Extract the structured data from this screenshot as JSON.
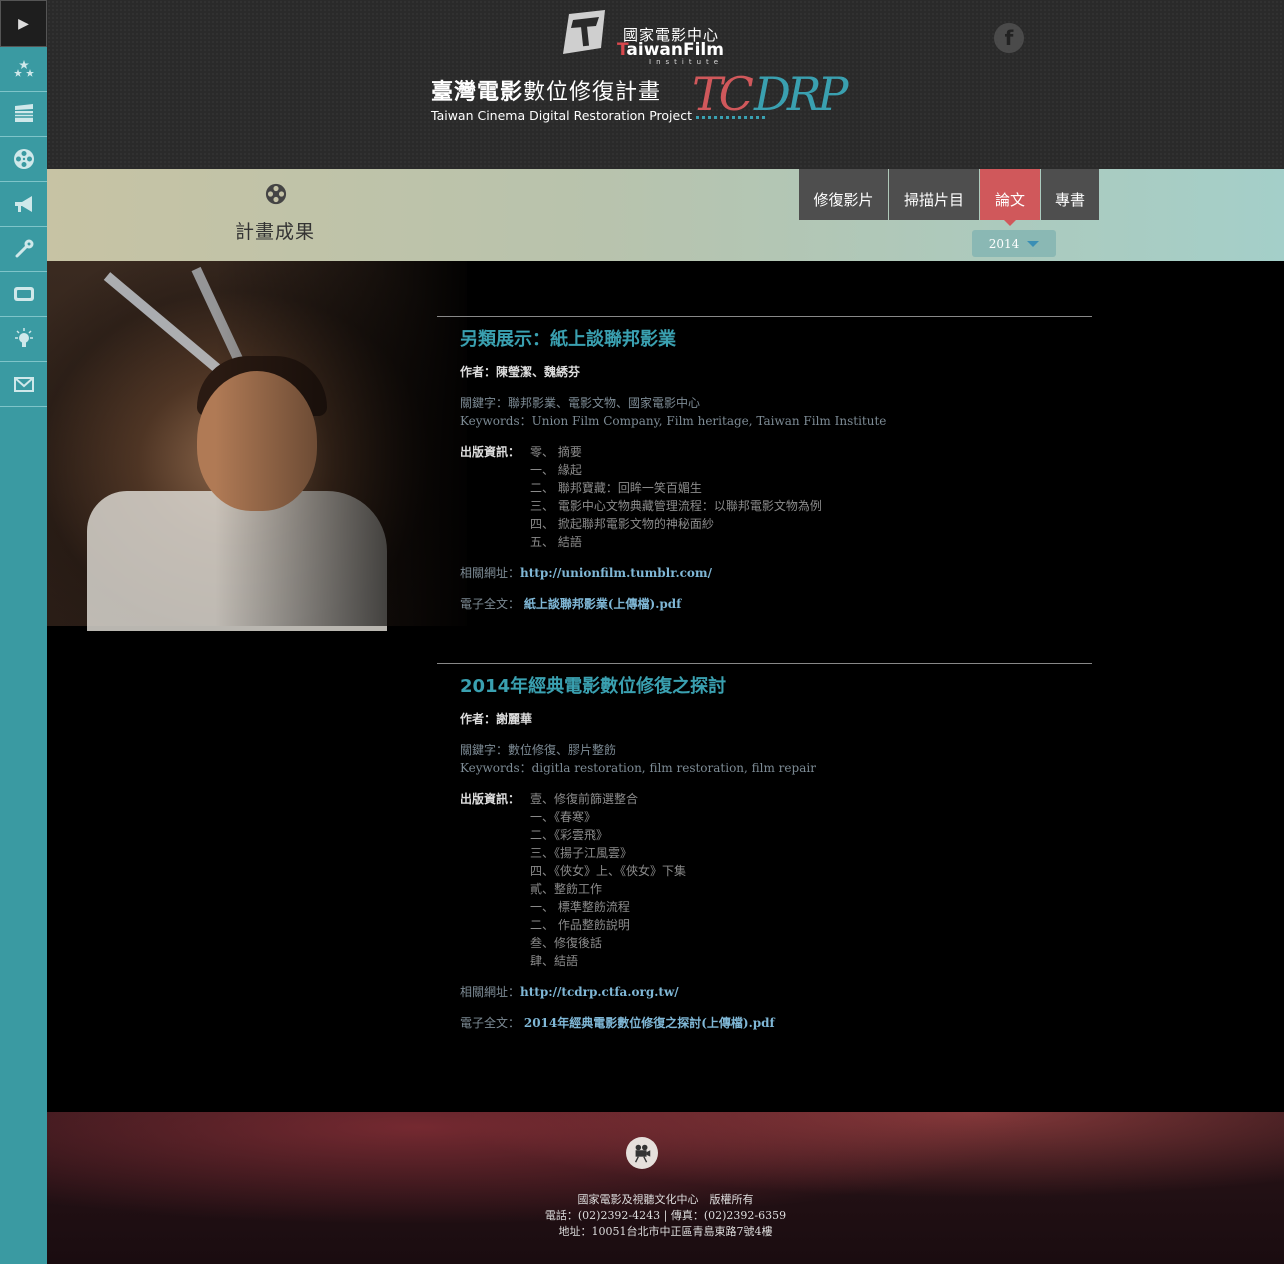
{
  "sidebar": {
    "items": [
      {
        "icon": "stars-icon"
      },
      {
        "icon": "film-clapper-icon"
      },
      {
        "icon": "film-reel-icon"
      },
      {
        "icon": "megaphone-icon"
      },
      {
        "icon": "wrench-icon"
      },
      {
        "icon": "tv-icon"
      },
      {
        "icon": "lightbulb-icon"
      },
      {
        "icon": "mail-icon"
      }
    ]
  },
  "header": {
    "tfi_zh": "國家電影中心",
    "tfi_en_t": "T",
    "tfi_en_rest": "aiwanFilm",
    "tfi_sub": "Institute",
    "project_zh_bold": "臺灣電影",
    "project_zh_light": "數位修復計畫",
    "project_en": "Taiwan Cinema Digital Restoration Project",
    "tcdrp": "TCDRP",
    "fb_glyph": "f",
    "colors": {
      "tc": "#d0585b",
      "drp": "#3aa0b0"
    }
  },
  "section": {
    "title": "計畫成果",
    "tabs": [
      "修復影片",
      "掃描片目",
      "論文",
      "專書"
    ],
    "active_tab": 2,
    "year": "2014"
  },
  "articles": [
    {
      "title": "另類展示：紙上談聯邦影業",
      "author": "作者：陳瑩潔、魏綉芬",
      "keywords_zh": "關鍵字：聯邦影業、電影文物、國家電影中心",
      "keywords_en": "Keywords：Union Film Company, Film heritage, Taiwan Film Institute",
      "pub_label": "出版資訊：",
      "pub_items": [
        "零、 摘要",
        "一、 緣起",
        "二、 聯邦寶藏：回眸一笑百媚生",
        "三、 電影中心文物典藏管理流程：以聯邦電影文物為例",
        "四、 掀起聯邦電影文物的神秘面紗",
        "五、 結語"
      ],
      "link_label": "相關網址：",
      "link_url": "http://unionfilm.tumblr.com/",
      "file_label": "電子全文：",
      "file_name": "紙上談聯邦影業(上傳檔).pdf"
    },
    {
      "title": "2014年經典電影數位修復之探討",
      "author": "作者：謝麗華",
      "keywords_zh": "關鍵字：數位修復、膠片整飭",
      "keywords_en": "Keywords：digitla restoration, film restoration, film repair",
      "pub_label": "出版資訊：",
      "pub_items": [
        "壹、修復前篩選整合",
        "一、《春寒》",
        "二、《彩雲飛》",
        "三、《揚子江風雲》",
        "四、《俠女》上、《俠女》下集",
        "貳、整飭工作",
        "一、 標準整飭流程",
        "二、 作品整飭說明",
        "叁、修復後話",
        "肆、結語"
      ],
      "link_label": "相關網址：",
      "link_url": "http://tcdrp.ctfa.org.tw/",
      "file_label": "電子全文：",
      "file_name": "2014年經典電影數位修復之探討(上傳檔).pdf"
    }
  ],
  "footer": {
    "line1": "國家電影及視聽文化中心　版權所有",
    "line2": "電話：(02)2392-4243 | 傳真：(02)2392-6359",
    "line3": "地址：10051台北市中正區青島東路7號4樓"
  }
}
